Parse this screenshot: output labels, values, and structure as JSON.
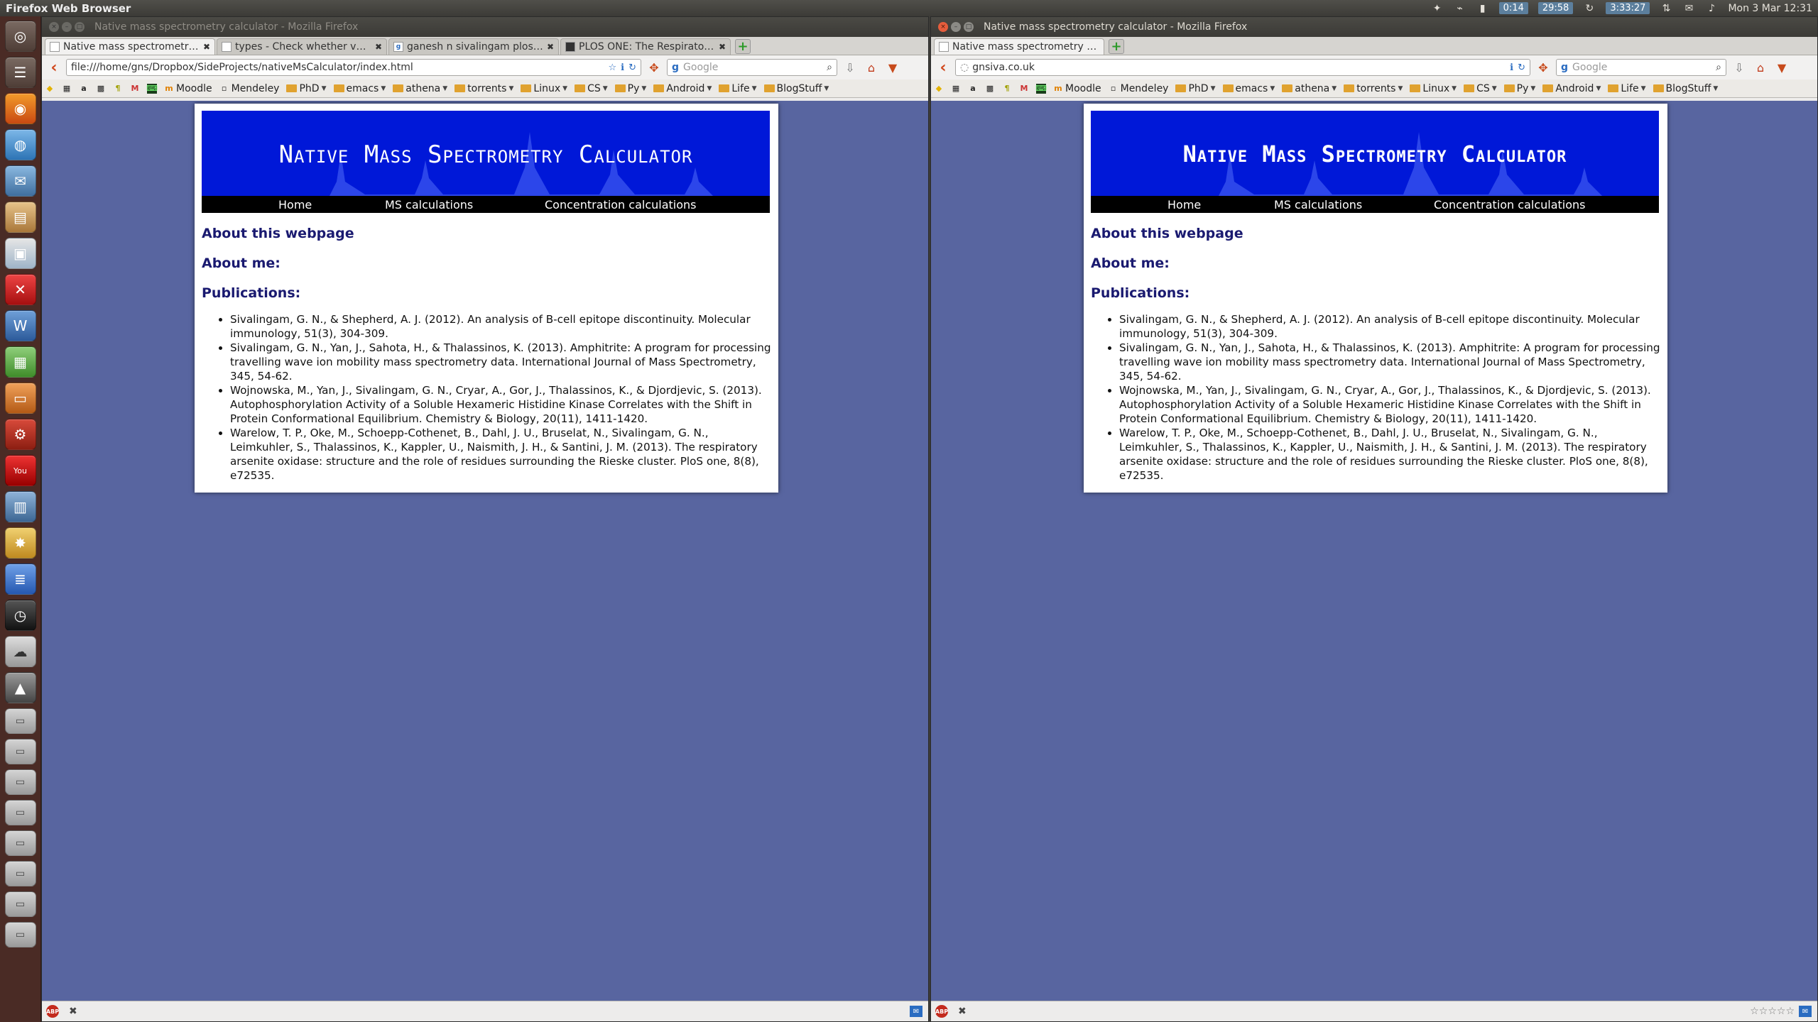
{
  "top_panel": {
    "app_title": "Firefox Web Browser",
    "battery_time": "0:14",
    "timer": "29:58",
    "clock_elapsed": "3:33:27",
    "datetime": "Mon 3 Mar 12:31"
  },
  "left_window": {
    "title": "Native mass spectrometry calculator - Mozilla Firefox",
    "tabs": [
      {
        "label": "Native mass spectrometry ...",
        "active": true
      },
      {
        "label": "types - Check whether varia...",
        "active": false
      },
      {
        "label": "ganesh n sivalingam plos on...",
        "active": false
      },
      {
        "label": "PLOS ONE: The Respiratory ...",
        "active": false
      }
    ],
    "url": "file:///home/gns/Dropbox/SideProjects/nativeMsCalculator/index.html",
    "search_placeholder": "Google"
  },
  "right_window": {
    "title": "Native mass spectrometry calculator - Mozilla Firefox",
    "tabs": [
      {
        "label": "Native mass spectrometry cal...",
        "active": true
      }
    ],
    "url": "gnsiva.co.uk",
    "search_placeholder": "Google"
  },
  "bookmarks": [
    {
      "label": "Moodle",
      "type": "link"
    },
    {
      "label": "Mendeley",
      "type": "link"
    },
    {
      "label": "PhD",
      "type": "folder"
    },
    {
      "label": "emacs",
      "type": "folder"
    },
    {
      "label": "athena",
      "type": "folder"
    },
    {
      "label": "torrents",
      "type": "folder"
    },
    {
      "label": "Linux",
      "type": "folder"
    },
    {
      "label": "CS",
      "type": "folder"
    },
    {
      "label": "Py",
      "type": "folder"
    },
    {
      "label": "Android",
      "type": "folder"
    },
    {
      "label": "Life",
      "type": "folder"
    },
    {
      "label": "BlogStuff",
      "type": "folder"
    }
  ],
  "page": {
    "banner_title": "Native Mass Spectrometry Calculator",
    "menu": [
      "Home",
      "MS calculations",
      "Concentration calculations"
    ],
    "section_about_page": "About this webpage",
    "section_about_me": "About me:",
    "section_publications": "Publications:",
    "publications": [
      "Sivalingam, G. N., & Shepherd, A. J. (2012). An analysis of B-cell epitope discontinuity. Molecular immunology, 51(3), 304-309.",
      "Sivalingam, G. N., Yan, J., Sahota, H., & Thalassinos, K. (2013). Amphitrite: A program for processing travelling wave ion mobility mass spectrometry data. International Journal of Mass Spectrometry, 345, 54-62.",
      "Wojnowska, M., Yan, J., Sivalingam, G. N., Cryar, A., Gor, J., Thalassinos, K., & Djordjevic, S. (2013). Autophosphorylation Activity of a Soluble Hexameric Histidine Kinase Correlates with the Shift in Protein Conformational Equilibrium. Chemistry & Biology, 20(11), 1411-1420.",
      "Warelow, T. P., Oke, M., Schoepp-Cothenet, B., Dahl, J. U., Bruselat, N., Sivalingam, G. N., Leimkuhler, S., Thalassinos, K., Kappler, U., Naismith, J. H., & Santini, J. M. (2013). The respiratory arsenite oxidase: structure and the role of residues surrounding the Rieske cluster. PloS one, 8(8), e72535."
    ]
  },
  "colors": {
    "page_background": "#5865a0",
    "banner": "#0018d8",
    "heading": "#1a1a70",
    "launcher": "#4a2b25"
  }
}
